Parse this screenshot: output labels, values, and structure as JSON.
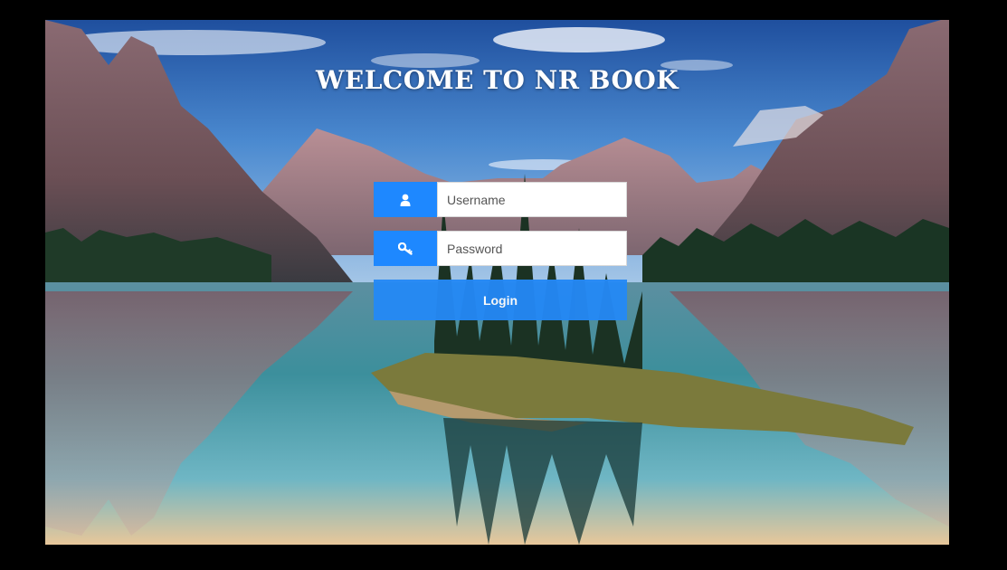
{
  "page": {
    "title": "WELCOME TO NR BOOK",
    "background": "landscape-mountain-lake-photo"
  },
  "form": {
    "username": {
      "placeholder": "Username",
      "value": "",
      "icon": "user-icon"
    },
    "password": {
      "placeholder": "Password",
      "value": "",
      "icon": "key-icon"
    },
    "login_label": "Login"
  },
  "colors": {
    "accent": "#1e88ff",
    "button": "#2488f5",
    "frame_background": "#000000",
    "title_text": "#ffffff"
  }
}
